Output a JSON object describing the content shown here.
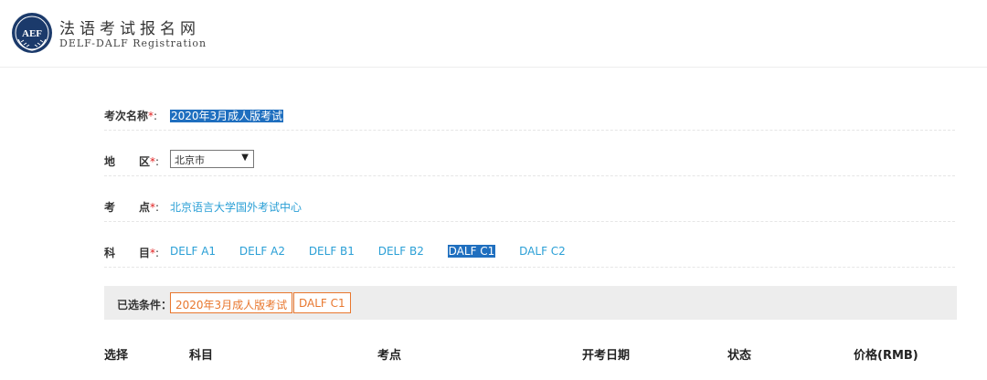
{
  "header": {
    "title": "法语考试报名网",
    "subtitle": "DELF-DALF Registration",
    "logo_text": "AEF"
  },
  "form": {
    "exam_name": {
      "label": "考次名称",
      "required_mark": "*",
      "colon": ":",
      "value": "2020年3月成人版考试"
    },
    "region": {
      "label_chars": [
        "地",
        "区"
      ],
      "required_mark": "*",
      "colon": ":",
      "value": "北京市",
      "arrow": "▼"
    },
    "center": {
      "label_chars": [
        "考",
        "点"
      ],
      "required_mark": "*",
      "colon": ":",
      "value": "北京语言大学国外考试中心"
    },
    "subject": {
      "label_chars": [
        "科",
        "目"
      ],
      "required_mark": "*",
      "colon": ":",
      "options": [
        "DELF A1",
        "DELF A2",
        "DELF B1",
        "DELF B2",
        "DALF C1",
        "DALF C2"
      ],
      "selected": "DALF C1"
    }
  },
  "selected_conditions": {
    "label": "已选条件：",
    "tags": [
      "2020年3月成人版考试",
      "DALF C1"
    ]
  },
  "table": {
    "headers": [
      "选择",
      "科目",
      "考点",
      "开考日期",
      "状态",
      "价格(RMB)"
    ]
  },
  "colors": {
    "link": "#2a9fd6",
    "highlight": "#1f6fbf",
    "tag_border": "#e8772e",
    "required": "#e02020",
    "logo": "#1b3a6b"
  }
}
